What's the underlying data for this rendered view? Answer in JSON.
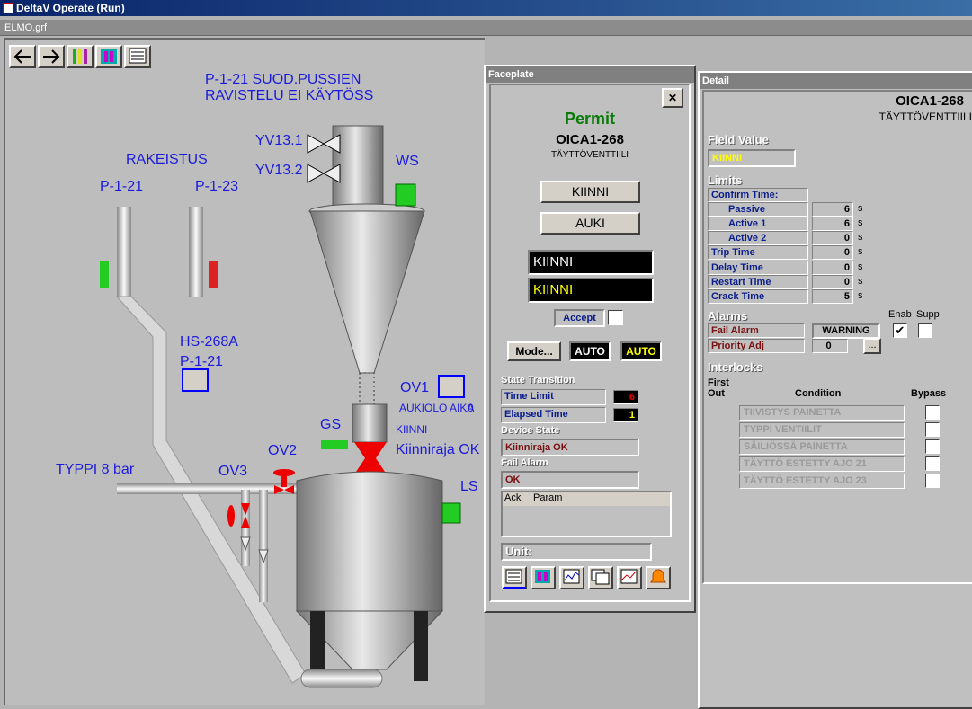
{
  "window": {
    "title": "DeltaV Operate (Run)",
    "document": "ELMO.grf"
  },
  "toolbar": {
    "icons": [
      "back-arrow-icon",
      "forward-arrow-icon",
      "bargraph-icon",
      "faceplate-icon",
      "detail-icon"
    ]
  },
  "process": {
    "header_line1": "P-1-21 SUOD.PUSSIEN",
    "header_line2": "RAVISTELU EI KÄYTÖSS",
    "rakeistus": "RAKEISTUS",
    "p121": "P-1-21",
    "p123": "P-1-23",
    "yv131": "YV13.1",
    "yv132": "YV13.2",
    "ws": "WS",
    "hs268a": "HS-268A",
    "hs_p121": "P-1-21",
    "ov1": "OV1",
    "aukiolo": "AUKIOLO AIKA",
    "aukiolo_val": "0",
    "kiinni": "KIINNI",
    "gs": "GS",
    "kiinniraja": "Kiinniraja OK",
    "ov2": "OV2",
    "typpi": "TYPPI 8 bar",
    "ov3": "OV3",
    "ls": "LS"
  },
  "faceplate": {
    "title": "Faceplate",
    "close": "✕",
    "status": "Permit",
    "tag": "OICA1-268",
    "desc": "TÄYTTÖVENTTIILI",
    "btn_close": "KIINNI",
    "btn_open": "AUKI",
    "pv": "KIINNI",
    "sp": "KIINNI",
    "accept": "Accept",
    "mode_btn": "Mode...",
    "mode_actual": "AUTO",
    "mode_target": "AUTO",
    "state_transition": "State Transition",
    "time_limit_label": "Time Limit",
    "time_limit": "6",
    "elapsed_label": "Elapsed Time",
    "elapsed": "1",
    "device_state_label": "Device State",
    "device_state": "Kiinniraja OK",
    "fail_alarm_label": "Fail Alarm",
    "fail_alarm": "OK",
    "ack_col": "Ack",
    "param_col": "Param",
    "unit_label": "Unit:",
    "bottom_icons": [
      "detail-icon",
      "faceplate-icon",
      "trend-icon",
      "diagnostics-icon",
      "history-icon",
      "alarm-icon"
    ]
  },
  "detail": {
    "title": "Detail",
    "tag": "OICA1-268",
    "desc": "TÄYTTÖVENTTIILI",
    "field_value_label": "Field Value",
    "field_value": "KIINNI",
    "limits_label": "Limits",
    "confirm_time": "Confirm Time:",
    "passive_label": "Passive",
    "passive": "6",
    "active1_label": "Active 1",
    "active1": "6",
    "active2_label": "Active 2",
    "active2": "0",
    "trip_label": "Trip Time",
    "trip": "0",
    "delay_label": "Delay Time",
    "delay": "0",
    "restart_label": "Restart Time",
    "restart": "0",
    "crack_label": "Crack Time",
    "crack": "5",
    "unit_s": "s",
    "alarms_label": "Alarms",
    "enab": "Enab",
    "supp": "Supp",
    "fail_alarm": "Fail Alarm",
    "warning": "WARNING",
    "priority_adj": "Priority Adj",
    "priority": "0",
    "more": "...",
    "interlocks_label": "Interlocks",
    "first": "First",
    "out": "Out",
    "condition": "Condition",
    "bypass": "Bypass",
    "conditions": [
      "TIIVISTYS PAINETTA",
      "TYPPI VENTIILIT",
      "SÄILIÖSSÄ PAINETTA",
      "TÄYTTÖ ESTETTY AJO 21",
      "TÄYTTÖ ESTETTY AJO 23"
    ]
  },
  "colors": {
    "permit": "#0a7a0a",
    "navy": "#0a1e8c",
    "valve_red": "#e00000",
    "valve_green": "#22cc22"
  }
}
